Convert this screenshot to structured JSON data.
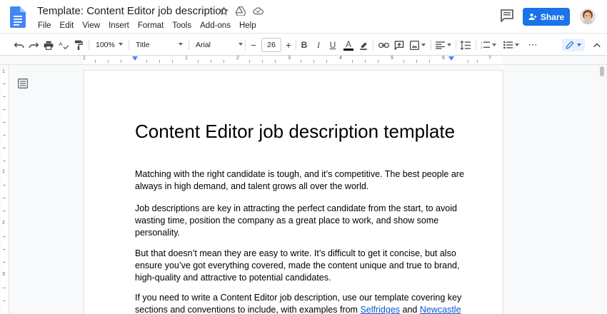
{
  "window": {
    "doc_title": "Template: Content Editor job description",
    "share_label": "Share"
  },
  "menu": [
    "File",
    "Edit",
    "View",
    "Insert",
    "Format",
    "Tools",
    "Add-ons",
    "Help"
  ],
  "toolbar": {
    "zoom": "100%",
    "style": "Title",
    "font": "Arial",
    "font_size": "26",
    "more": "⋯"
  },
  "ruler": {
    "h_labels": [
      "1",
      "1",
      "2",
      "3",
      "4",
      "5",
      "6",
      "7"
    ],
    "v_labels": [
      "1",
      "1",
      "2",
      "3"
    ]
  },
  "document": {
    "heading": "Content Editor job description template",
    "paragraphs": [
      {
        "lines": [
          "Matching with the right candidate is tough, and it’s competitive. The best people are",
          "always in high demand, and talent grows all over the world."
        ]
      },
      {
        "lines": [
          "Job descriptions are key in attracting the perfect candidate from the start, to avoid",
          "wasting time, position the company as a great place to work, and show some",
          "personality."
        ]
      },
      {
        "lines": [
          "But that doesn’t mean they are easy to write. It’s difficult to get it concise, but also",
          "ensure you’ve got everything covered, made the content unique and true to brand,",
          "high-quality and attractive to potential candidates."
        ]
      }
    ],
    "last_para": {
      "line1": "If you need to write a Content Editor job description, use our template covering key",
      "line2_pre": "sections and conventions to include, with examples from ",
      "link1": "Selfridges",
      "and": " and ",
      "link2": "Newcastle"
    }
  },
  "colors": {
    "accent": "#1a73e8",
    "doc_icon": "#4285f4",
    "link": "#1155cc"
  }
}
